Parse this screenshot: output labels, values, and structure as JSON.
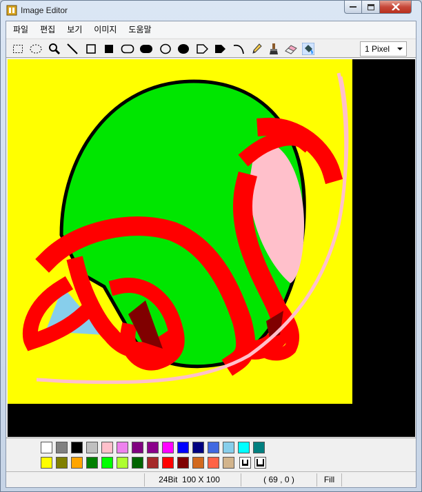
{
  "window": {
    "title": "Image Editor",
    "controls": {
      "minimize": "minimize-icon",
      "maximize": "maximize-icon",
      "close": "close-icon"
    }
  },
  "menu": [
    "파일",
    "편집",
    "보기",
    "이미지",
    "도움말"
  ],
  "toolbar": {
    "tools": [
      {
        "name": "rect-select-tool",
        "icon": "dashed-rect-icon"
      },
      {
        "name": "ellipse-select-tool",
        "icon": "dashed-ellipse-icon"
      },
      {
        "name": "zoom-tool",
        "icon": "magnifier-icon"
      },
      {
        "name": "line-tool",
        "icon": "line-icon"
      },
      {
        "name": "rect-tool",
        "icon": "rect-outline-icon"
      },
      {
        "name": "filled-rect-tool",
        "icon": "rect-filled-icon"
      },
      {
        "name": "rounded-rect-tool",
        "icon": "rounded-rect-outline-icon"
      },
      {
        "name": "filled-rounded-rect-tool",
        "icon": "rounded-rect-filled-icon"
      },
      {
        "name": "ellipse-tool",
        "icon": "ellipse-outline-icon"
      },
      {
        "name": "filled-ellipse-tool",
        "icon": "ellipse-filled-icon"
      },
      {
        "name": "polygon-tool",
        "icon": "polygon-outline-icon"
      },
      {
        "name": "filled-polygon-tool",
        "icon": "polygon-filled-icon"
      },
      {
        "name": "curve-tool",
        "icon": "curve-icon"
      },
      {
        "name": "pencil-tool",
        "icon": "pencil-icon"
      },
      {
        "name": "brush-tool",
        "icon": "brush-icon"
      },
      {
        "name": "eraser-tool",
        "icon": "eraser-icon"
      },
      {
        "name": "fill-tool",
        "icon": "paint-bucket-icon"
      }
    ],
    "line_width": "1 Pixel"
  },
  "palette": {
    "row1": [
      "#ffffff",
      "#808080",
      "#000000",
      "#c0c0c0",
      "#ffc0cb",
      "#ee82ee",
      "#800080",
      "#8b008b",
      "#ff00ff",
      "#0000ff",
      "#000080",
      "#4169e1",
      "#87ceeb",
      "#00ffff",
      "#008080"
    ],
    "row2": [
      "#ffff00",
      "#808000",
      "#ffa500",
      "#008000",
      "#00ff00",
      "#adff2f",
      "#006400",
      "#a52a2a",
      "#ff0000",
      "#800000",
      "#d2691e",
      "#ff6347",
      "#d2b48c"
    ],
    "custom": [
      "custom-color-icon",
      "custom-color-icon"
    ]
  },
  "status": {
    "format": "24Bit",
    "size": "100 X 100",
    "cursor": "( 69 , 0 )",
    "tool": "Fill"
  },
  "colors": {
    "canvas_bg": "#ffff00",
    "shape_fill": "#00e600",
    "stroke_red": "#ff0000",
    "pink": "#ffc0cb",
    "light_blue": "#87ceeb",
    "dark_red": "#800000",
    "outline": "#000000"
  }
}
